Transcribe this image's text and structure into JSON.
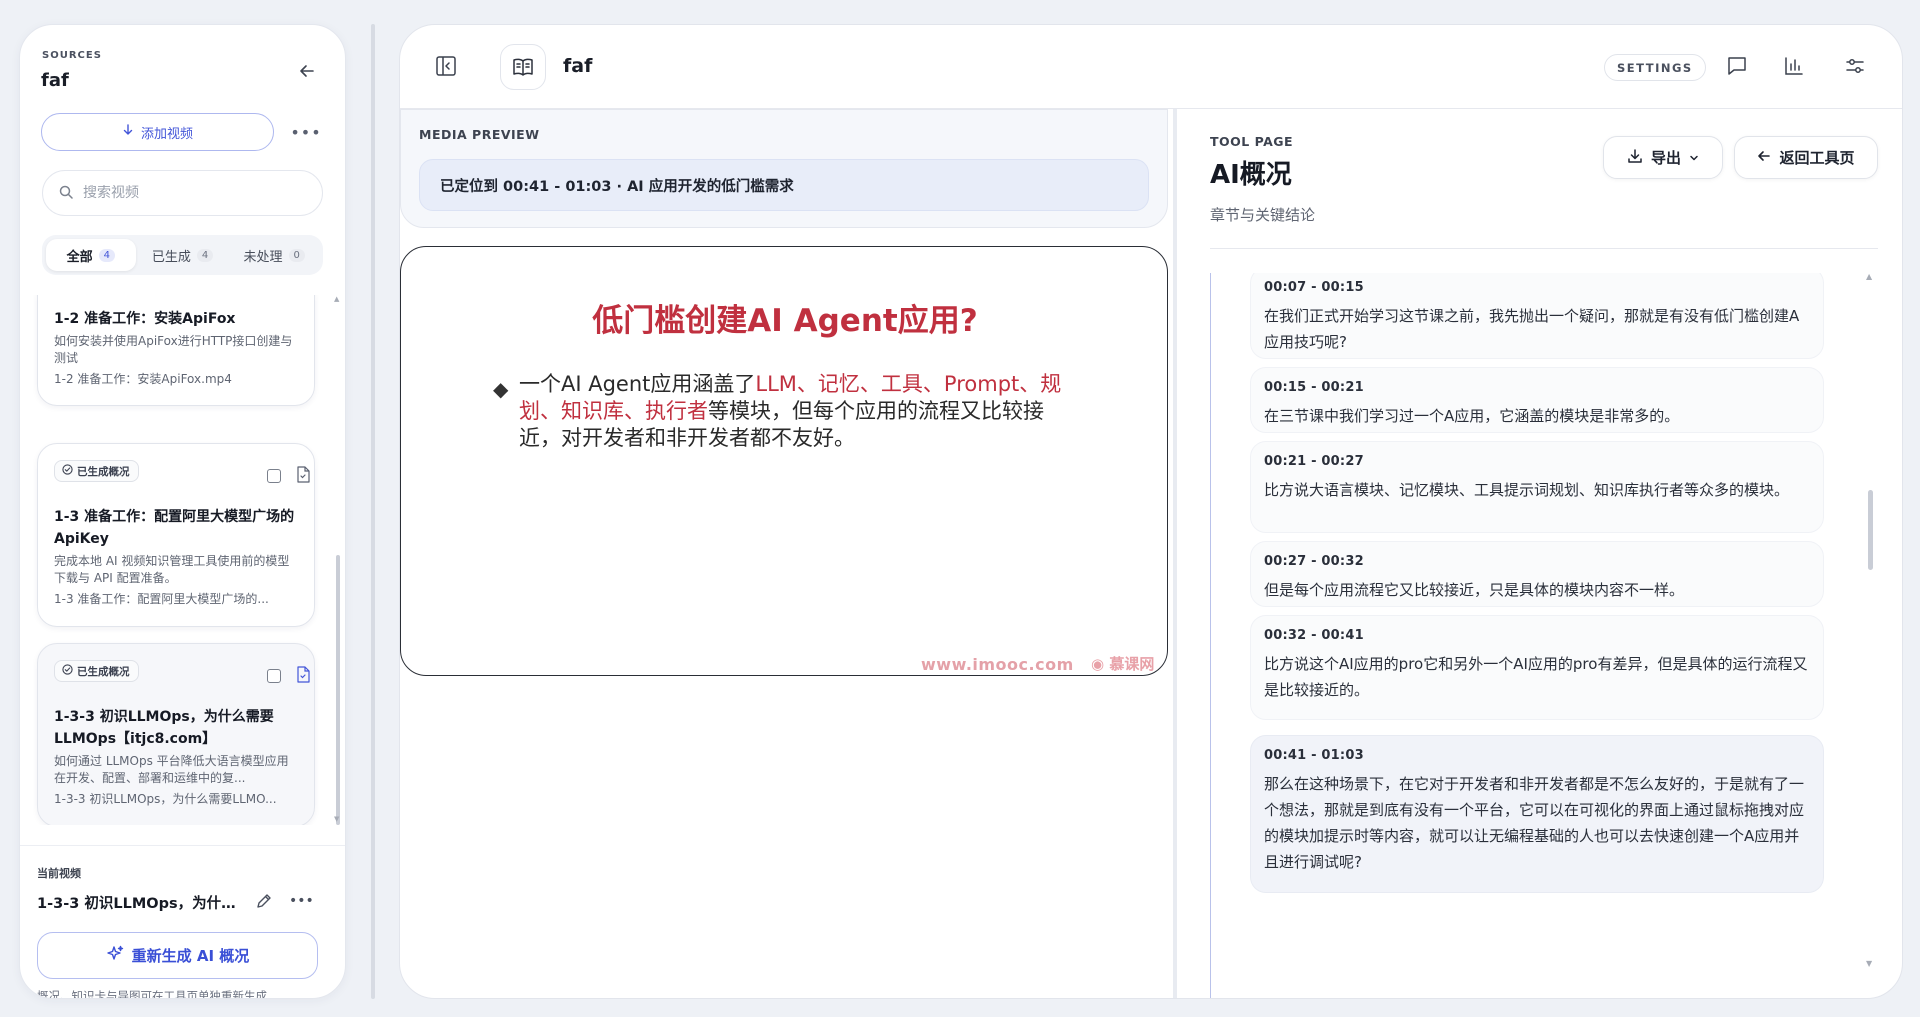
{
  "sidebar": {
    "eyebrow": "SOURCES",
    "title": "faf",
    "add_video_label": "添加视频",
    "search_placeholder": "搜索视频",
    "filters": [
      {
        "label": "全部",
        "count": "4"
      },
      {
        "label": "已生成",
        "count": "4"
      },
      {
        "label": "未处理",
        "count": "0"
      }
    ],
    "cards": [
      {
        "title": "1-2 准备工作：安装ApiFox",
        "desc": "如何安装并使用ApiFox进行HTTP接口创建与测试",
        "file": "1-2 准备工作：安装ApiFox.mp4"
      },
      {
        "badge": "已生成概况",
        "title": "1-3 准备工作：配置阿里大模型广场的ApiKey",
        "desc": "完成本地 AI 视频知识管理工具使用前的模型下载与 API 配置准备。",
        "file": "1-3 准备工作：配置阿里大模型广场的..."
      },
      {
        "badge": "已生成概况",
        "title": "1-3-3 初识LLMOps，为什么需要LLMOps【itjc8.com】",
        "desc": "如何通过 LLMOps 平台降低大语言模型应用在开发、配置、部署和运维中的复...",
        "file": "1-3-3 初识LLMOps，为什么需要LLMO..."
      }
    ],
    "current_eyebrow": "当前视频",
    "current_title": "1-3-3 初识LLMOps，为什...",
    "regen_label": "重新生成 AI 概况",
    "note": "概况、知识卡与导图可在工具页单独重新生成"
  },
  "topbar": {
    "title": "faf",
    "settings_label": "SETTINGS"
  },
  "media": {
    "eyebrow": "MEDIA PREVIEW",
    "located_text": "已定位到 00:41 - 01:03 · AI 应用开发的低门槛需求",
    "slide": {
      "title": "低门槛创建AI Agent应用?",
      "body_prefix": "一个AI Agent应用涵盖了",
      "body_highlight": "LLM、记忆、工具、Prompt、规划、知识库、执行者",
      "body_suffix": "等模块，但每个应用的流程又比较接近，对开发者和非开发者都不友好。",
      "watermark": "www.imooc.com",
      "logo": "慕课网"
    }
  },
  "tool": {
    "eyebrow": "TOOL PAGE",
    "title": "AI概况",
    "subtitle": "章节与关键结论",
    "export_label": "导出",
    "back_label": "返回工具页",
    "segments": [
      {
        "time": "00:07 - 00:15",
        "text": "在我们正式开始学习这节课之前，我先抛出一个疑问，那就是有没有低门槛创建A应用技巧呢?"
      },
      {
        "time": "00:15 - 00:21",
        "text": "在三节课中我们学习过一个A应用，它涵盖的模块是非常多的。"
      },
      {
        "time": "00:21 - 00:27",
        "text": "比方说大语言模块、记忆模块、工具提示词规划、知识库执行者等众多的模块。"
      },
      {
        "time": "00:27 - 00:32",
        "text": "但是每个应用流程它又比较接近，只是具体的模块内容不一样。"
      },
      {
        "time": "00:32 - 00:41",
        "text": "比方说这个AI应用的pro它和另外一个AI应用的pro有差异，但是具体的运行流程又是比较接近的。"
      },
      {
        "time": "00:41 - 01:03",
        "text": "那么在这种场景下，在它对于开发者和非开发者都是不怎么友好的，于是就有了一个想法，那就是到底有没有一个平台，它可以在可视化的界面上通过鼠标拖拽对应的模块加提示时等内容，就可以让无编程基础的人也可以去快速创建一个A应用并且进行调试呢?"
      }
    ]
  },
  "colors": {
    "accent": "#4356d8",
    "slide_red": "#c0303f"
  }
}
